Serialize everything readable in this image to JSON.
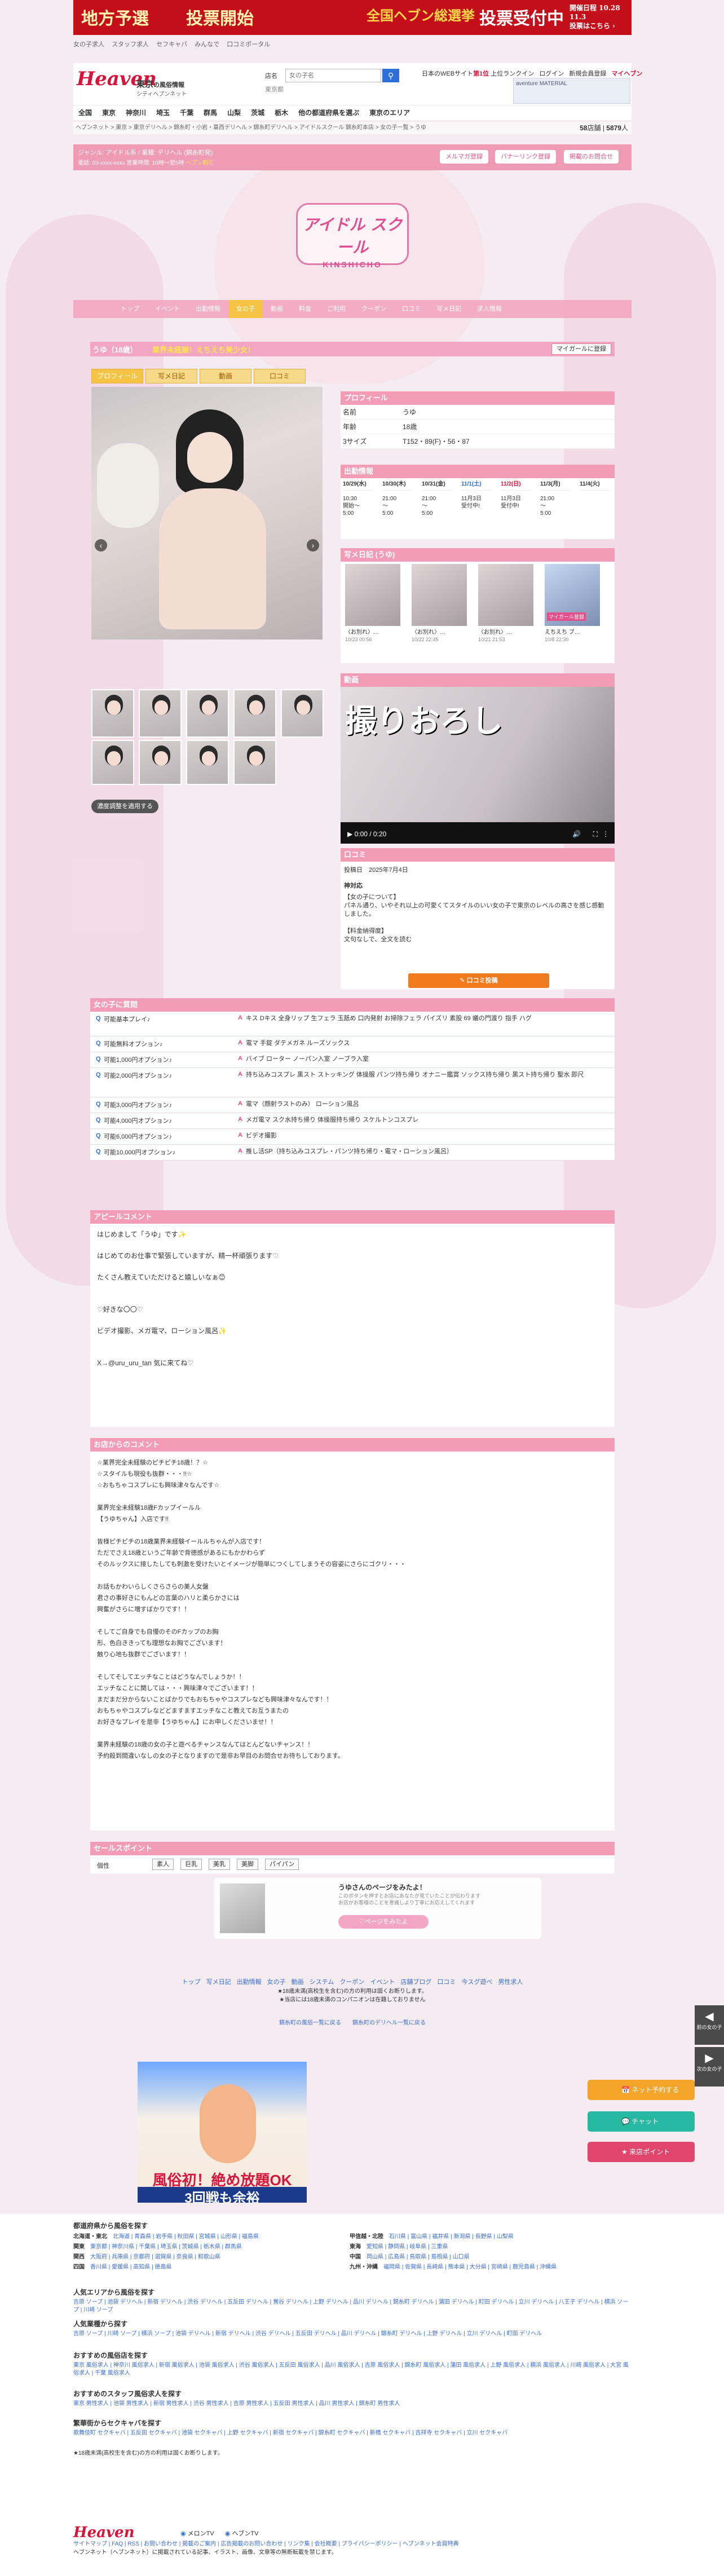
{
  "banner": {
    "t1": "地方予選",
    "t2": "投票開始",
    "t3": "全国ヘブン総選挙",
    "t4": "投票受付中",
    "t5": "開催日程 10.28 11.3",
    "t6": "投票はこちら ›"
  },
  "topstrip": [
    "女の子求人",
    "スタッフ求人",
    "セフキャバ",
    "みんなで",
    "口コミポータル"
  ],
  "header": {
    "logo": "Heaven",
    "area": "東京",
    "area_suffix": "の風俗情報",
    "sub": "シティヘブンネット",
    "search_label": "店名",
    "search_placeholder": "女の子名",
    "search_icon": "search-icon",
    "search_hint": "東京都",
    "right1": "日本のWEBサイト",
    "right1b": "第1位",
    "right2": "上位ランクイン",
    "login": "ログイン",
    "register": "新規会員登録",
    "mypage": "マイヘブン",
    "ad_text": "aventure MATERIAL"
  },
  "areanav": [
    "全国",
    "東京",
    "神奈川",
    "埼玉",
    "千葉",
    "群馬",
    "山梨",
    "茨城",
    "栃木",
    "他の都道府県を選ぶ",
    "東京のエリア"
  ],
  "breadcrumb": "ヘブンネット > 東京 > 東京デリヘル > 錦糸町・小岩・葛西デリヘル > 錦糸町デリヘル > アイドルスクール 錦糸町本店 > 女の子一覧 > うゆ",
  "counts": {
    "shops_label": "店舗",
    "shops": "58",
    "girls_label": "人",
    "girls": "5879"
  },
  "shopbar": {
    "line1": "ジャンル: アイドル系 / 業種: デリヘル (錦糸町発)",
    "line2": "電話: 03-xxxx-xxxx 営業時間: 10時～翌5時",
    "tag": "ヘブン割引",
    "btn1": "メルマガ登録",
    "btn2": "バナーリンク登録",
    "btn3": "掲載のお問合せ"
  },
  "shoplogo": {
    "l1": "アイドル スクール",
    "l2": "KINSHICHO"
  },
  "shopmenu": [
    "トップ",
    "イベント",
    "出勤情報",
    "女の子",
    "動画",
    "料金",
    "ご利用",
    "クーポン",
    "口コミ",
    "写メ日記",
    "求人情報"
  ],
  "girl": {
    "name": "うゆ（18歳）",
    "catch": "業界未経験！えちえち美少女！",
    "fav": "マイガールに登録"
  },
  "tabs": [
    "プロフィール",
    "写メ日記",
    "動画",
    "口コミ"
  ],
  "profile": {
    "title": "プロフィール",
    "rows": [
      {
        "k": "名前",
        "v": "うゆ"
      },
      {
        "k": "年齢",
        "v": "18歳"
      },
      {
        "k": "3サイズ",
        "v": "T152・89(F)・56・87"
      }
    ]
  },
  "schedule": {
    "title": "出勤情報",
    "days": [
      {
        "d": "10/29(水)",
        "t": "10:30\n開始～\n5:00"
      },
      {
        "d": "10/30(木)",
        "t": "21:00\n～\n5:00"
      },
      {
        "d": "10/31(金)",
        "t": "21:00\n～\n5:00"
      },
      {
        "d": "11/1(土)",
        "t": "11月3日\n受付中!"
      },
      {
        "d": "11/2(日)",
        "t": "11月3日\n受付中!"
      },
      {
        "d": "11/3(月)",
        "t": "21:00\n～\n5:00"
      },
      {
        "d": "11/4(火)",
        "t": ""
      }
    ]
  },
  "diary": {
    "title": "写メ日記 (うゆ)",
    "cards": [
      {
        "t": "〈お別れ〉…",
        "dt": "10/23 00:56"
      },
      {
        "t": "〈お別れ〉…",
        "dt": "10/22 22:45"
      },
      {
        "t": "〈お別れ〉…",
        "dt": "10/21 21:53"
      },
      {
        "t": "えちえち ブ…",
        "dt": "10/8 22:30"
      }
    ],
    "badge": "マイガール登録"
  },
  "video": {
    "title": "動画",
    "overlay": "撮りおろし",
    "time": "0:00 / 0:20"
  },
  "review": {
    "title": "口コミ",
    "date_label": "投稿日",
    "date": "2025年7月4日",
    "head": "神対応",
    "body": "【女の子について】\nパネル通り、いやそれ以上の可愛くてスタイルのいい女の子で東京のレベルの高さを感じ感動しました。\n\n【料金納得度】\n文句なしで、全文を読む",
    "button": "口コミ投稿"
  },
  "options": {
    "title": "女の子に質問",
    "rows": [
      {
        "q": "可能基本プレイ♪",
        "a": "キス Dキス 全身リップ 生フェラ 玉舐め 口内発射 お掃除フェラ パイズリ 素股 69 蟻の門渡り 指手 ハグ"
      },
      {
        "q": "可能無料オプション♪",
        "a": "電マ 手錠 ダテメガネ ルーズソックス"
      },
      {
        "q": "可能1,000円オプション♪",
        "a": "バイブ ローター ノーパン入室 ノーブラ入室"
      },
      {
        "q": "可能2,000円オプション♪",
        "a": "持ち込みコスプレ 黒スト ストッキング 体操服 パンツ持ち帰り オナニー鑑賞 ソックス持ち帰り 黒スト持ち帰り 聖水 即尺"
      },
      {
        "q": "可能3,000円オプション♪",
        "a": "電マ（顔射ラストのみ） ローション風呂"
      },
      {
        "q": "可能4,000円オプション♪",
        "a": "メガ電マ スク水持ち帰り 体操服持ち帰り スケルトンコスプレ"
      },
      {
        "q": "可能6,000円オプション♪",
        "a": "ビデオ撮影"
      },
      {
        "q": "可能10,000円オプション♪",
        "a": "推し活SP（持ち込みコスプレ・パンツ持ち帰り・電マ・ローション風呂）"
      }
    ]
  },
  "appeal": {
    "title": "アピールコメント",
    "body": "はじめまして「うゆ」です✨\n\nはじめてのお仕事で緊張していますが、精一杯頑張ります♡\n\nたくさん教えていただけると嬉しいなぁ😊\n\n\n♡好きな〇〇♡\n\nビデオ撮影、メガ電マ、ローション風呂✨\n\n\nX→@uru_uru_tan 気に来てね♡"
  },
  "shopcomment": {
    "title": "お店からのコメント",
    "body": "☆業界完全未経験のピチピチ18歳！？☆\n☆スタイルも現役も抜群・・・!!☆\n☆おもちゃコスプレにも興味津々なんです☆\n\n業界完全未経験18歳Fカップイールル\n【うゆちゃん】入店です!!\n\n皆様ピチピチの18歳業界未経験イールルちゃんが入店です！\nただでさえ18歳というご年齢で背徳感があるにもかかわらず\nそのルックスに接したしても刺激を受けたいとイメージが簡単につくしてしまうその容姿にさらにゴクリ・・・\n\nお話もかわいらしくさらさらの美人女盤\n君さの事好きにもんどの言葉のハリと柔らかさには\n興奮がさらに増すばかりです！！\n\nそしてご自身でも自慢のそのFカップのお胸\n形、色白ききっても理想なお胸でございます！\n触り心地も抜群でございます！！\n\nそしてそしてエッチなことはどうなんでしょうか！！\nエッチなことに関しては・・・興味津々でございます！！\nまだまだ分からないことばかりでもおもちゃやコスプレなども興味津々なんです！！\nおもちゃやコスプレなどどますますエッチなこと教えてお互うまたの\nお好きなプレイを是非【うゆちゃん】にお申しくださいませ！！\n\n業界未経験の18歳の女の子と遊べるチャンスなんてはとんどないチャンス！！\n予約殺到間違いなしの女の子となりますので是非お早目のお問合せお待ちしております。"
  },
  "salespoints": {
    "title": "セールスポイント",
    "label": "個性",
    "tags": [
      "素人",
      "巨乳",
      "美乳",
      "美脚",
      "パイパン"
    ]
  },
  "promo": {
    "t1": "うゆさんのページをみたよ！",
    "t2": "このボタンを押すとお店にあなたが見ていたことが伝わります\nお店がお客様のことを意識しより丁寧にお応えしてくれます",
    "btn": "♡ページをみたよ"
  },
  "footlinks": [
    "トップ",
    "写メ日記",
    "出勤情報",
    "女の子",
    "動画",
    "システム",
    "クーポン",
    "イベント",
    "店舗ブログ",
    "口コミ",
    "今スグ遊べ",
    "男性求人"
  ],
  "footnote": "★18歳未満(高校生を含む)の方の利用は固くお断りします。\n★当店には18歳未満のコンパニオンは在籍しておりません",
  "footnote2": "錦糸町の風俗一覧に戻る　　錦糸町のデリヘル一覧に戻る",
  "side": {
    "back": "前の女の子",
    "next": "次の女の子"
  },
  "float": {
    "btn1": "ネット予約する",
    "btn2": "チャット",
    "btn3": "来店ポイント"
  },
  "ad": {
    "a1": "風俗初！絶め放題OK",
    "a2": "3回戦も余裕"
  },
  "footer": {
    "h1": "都道府県から風俗を探す",
    "regions": [
      {
        "r": "北海道・東北",
        "v": "北海道 | 青森県 | 岩手県 | 秋田県 | 宮城県 | 山形県 | 福島県"
      },
      {
        "r": "関東",
        "v": "東京都 | 神奈川県 | 千葉県 | 埼玉県 | 茨城県 | 栃木県 | 群馬県"
      },
      {
        "r": "関西",
        "v": "大阪府 | 兵庫県 | 京都府 | 滋賀県 | 奈良県 | 和歌山県"
      },
      {
        "r": "四国",
        "v": "香川県 | 愛媛県 | 高知県 | 徳島県"
      }
    ],
    "regions2": [
      {
        "r": "甲信越・北陸",
        "v": "石川県 | 富山県 | 福井県 | 新潟県 | 長野県 | 山梨県"
      },
      {
        "r": "東海",
        "v": "愛知県 | 静岡県 | 岐阜県 | 三重県"
      },
      {
        "r": "中国",
        "v": "岡山県 | 広島県 | 鳥取県 | 島根県 | 山口県"
      },
      {
        "r": "九州・沖縄",
        "v": "福岡県 | 佐賀県 | 長崎県 | 熊本県 | 大分県 | 宮崎県 | 鹿児島県 | 沖縄県"
      }
    ],
    "h2": "人気エリアから風俗を探す",
    "l2": "吉原 ソープ | 池袋 デリヘル | 新宿 デリヘル | 渋谷 デリヘル | 五反田 デリヘル | 鶯谷 デリヘル | 上野 デリヘル | 品川 デリヘル | 錦糸町 デリヘル | 蒲田 デリヘル | 町田 デリヘル | 立川 デリヘル | 八王子 デリヘル | 横浜 ソープ | 川崎 ソープ",
    "h3": "人気業種から探す",
    "l3": "吉原 ソープ | 川崎 ソープ | 横浜 ソープ | 池袋 デリヘル | 新宿 デリヘル | 渋谷 デリヘル | 五反田 デリヘル | 品川 デリヘル | 錦糸町 デリヘル | 上野 デリヘル | 立川 デリヘル | 町田 デリヘル",
    "h4": "おすすめの風俗店を探す",
    "l4": "東京 風俗求人 | 神奈川 風俗求人 | 新宿 風俗求人 | 池袋 風俗求人 | 渋谷 風俗求人 | 五反田 風俗求人 | 品川 風俗求人 | 吉原 風俗求人 | 錦糸町 風俗求人 | 蒲田 風俗求人 | 上野 風俗求人 | 横浜 風俗求人 | 川崎 風俗求人 | 大宮 風俗求人 | 千葉 風俗求人",
    "h5": "おすすめのスタッフ風俗求人を探す",
    "l5": "東京 男性求人 | 池袋 男性求人 | 新宿 男性求人 | 渋谷 男性求人 | 吉原 男性求人 | 五反田 男性求人 | 品川 男性求人 | 錦糸町 男性求人",
    "h6": "繁華街からセクキャバを探す",
    "l6": "歌舞伎町 セクキャバ | 五反田 セクキャバ | 池袋 セクキャバ | 上野 セクキャバ | 新宿 セクキャバ | 錦糸町 セクキャバ | 新橋 セクキャバ | 吉祥寺 セクキャバ | 立川 セクキャバ",
    "note": "★18歳未満(高校生を含む)の方の利用は固くお断りします。",
    "logo": "Heaven",
    "tv1": "メロンTV",
    "tv2": "ヘブンTV",
    "bottom1": "サイトマップ | FAQ | RSS | お問い合わせ | 掲載のご案内 | 広告掲載のお問い合わせ | リンク集 | 会社概要 | プライバシーポリシー | ヘブンネット会員特典",
    "bottom2": "ヘブンネット（ヘブンネット）に掲載されている記事、イラスト、画像、文章等の無断転載を禁じます。"
  }
}
